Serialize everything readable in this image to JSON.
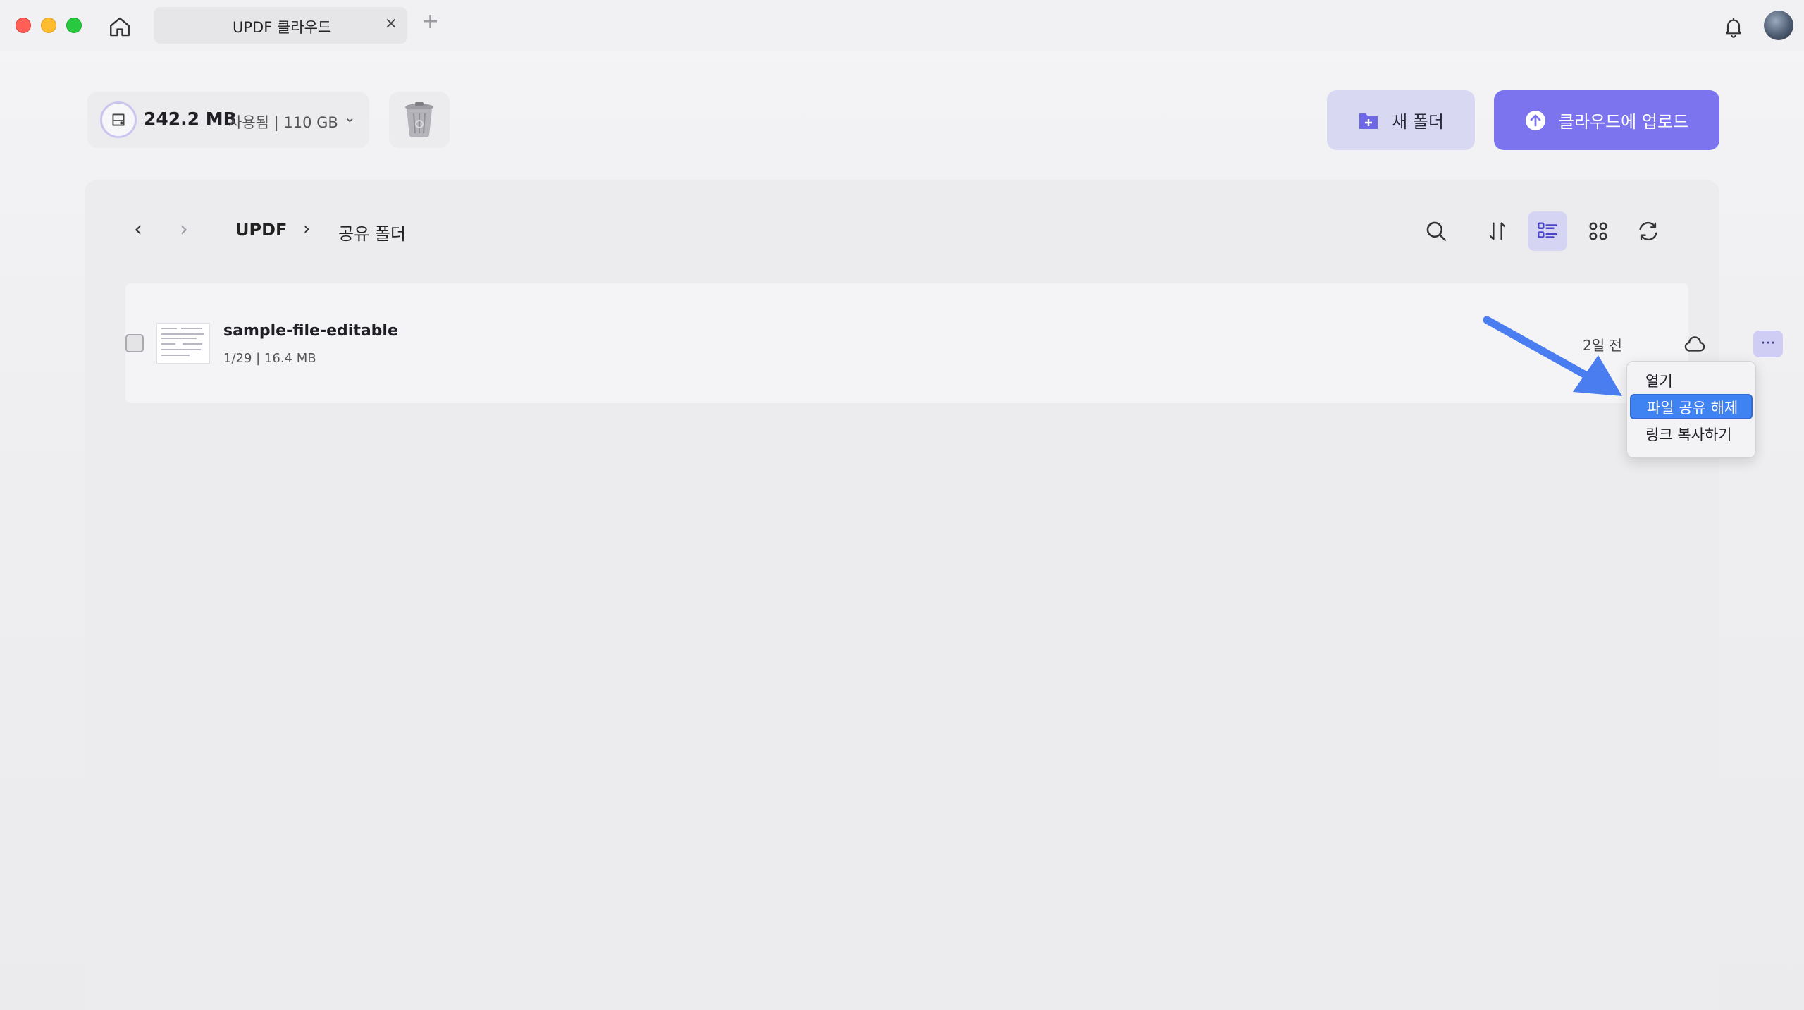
{
  "window": {
    "tab_title": "UPDF 클라우드",
    "tab_close": "×",
    "tab_add": "+"
  },
  "storage": {
    "used": "242.2 MB",
    "rest": "사용됨 | 110 GB",
    "caret": "⌄"
  },
  "actions": {
    "new_folder": "새 폴더",
    "upload": "클라우드에 업로드"
  },
  "breadcrumb": {
    "back": "‹",
    "forward": "›",
    "root": "UPDF",
    "separator": "›",
    "current": "공유 폴더"
  },
  "file": {
    "name": "sample-file-editable",
    "meta": "1/29  |  16.4 MB",
    "date": "2일 전",
    "more": "···"
  },
  "context_menu": {
    "items": [
      "열기",
      "파일 공유 해제",
      "링크 복사하기"
    ],
    "highlighted_index": 1
  },
  "colors": {
    "accent": "#7b74ee",
    "accent_light": "#d9d8f3",
    "menu_highlight": "#3f82f2",
    "annotation_arrow": "#4a7df0"
  },
  "icons": {
    "home": "home-icon",
    "bell": "bell-icon",
    "storage": "drive-icon",
    "trash": "trash-icon",
    "folder_add": "folder-plus-icon",
    "upload": "upload-arrow-icon",
    "search": "search-icon",
    "sort": "sort-icon",
    "list_view": "list-view-icon",
    "grid_view": "grid-view-icon",
    "refresh": "refresh-icon",
    "cloud": "cloud-icon"
  }
}
